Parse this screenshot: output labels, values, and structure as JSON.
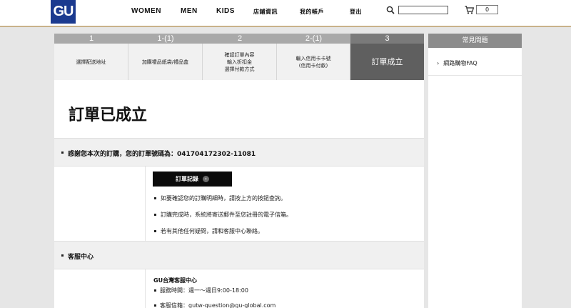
{
  "header": {
    "logo_text": "GU",
    "nav": [
      {
        "label": "WOMEN"
      },
      {
        "label": "MEN"
      },
      {
        "label": "KIDS"
      },
      {
        "label": "店鋪資訊"
      },
      {
        "label": "我的帳戶"
      },
      {
        "label": "登出"
      }
    ],
    "search_value": "",
    "cart_count": "0"
  },
  "steps": [
    {
      "num": "1",
      "label": "選擇配送地址"
    },
    {
      "num": "1-(1)",
      "label": "加購禮品紙袋/禮品盒"
    },
    {
      "num": "2",
      "label": "確認訂單內容\n輸入折扣金\n選擇付款方式"
    },
    {
      "num": "2-(1)",
      "label": "輸入信用卡卡號\n(信用卡付款)"
    },
    {
      "num": "3",
      "label": "訂單成立"
    }
  ],
  "main": {
    "title": "訂單已成立",
    "thanks": "感謝您本次的訂購，您的訂單號碼為：041704172302-11081",
    "order_button": "訂單記錄",
    "notes": [
      "如要確認您的訂購明細時，請按上方的按鈕查詢。",
      "訂購完成時，系統將寄送郵件至您註冊的電子信箱。",
      "若有其他任何疑問，請和客服中心聯絡。"
    ],
    "cs_header": "客服中心",
    "cs_title": "GU台灣客服中心",
    "cs_hours": "服務時間：週一～週日9:00-18:00",
    "cs_email": "客服信箱：gutw-question@gu-global.com"
  },
  "faq": {
    "header": "常見問題",
    "item": "網路購物FAQ"
  },
  "colors": {
    "logo_bg": "#1b3a8f",
    "active_step": "#5f5f5f",
    "step_num": "#a9a9a9",
    "accent_line": "#c9b28a"
  }
}
